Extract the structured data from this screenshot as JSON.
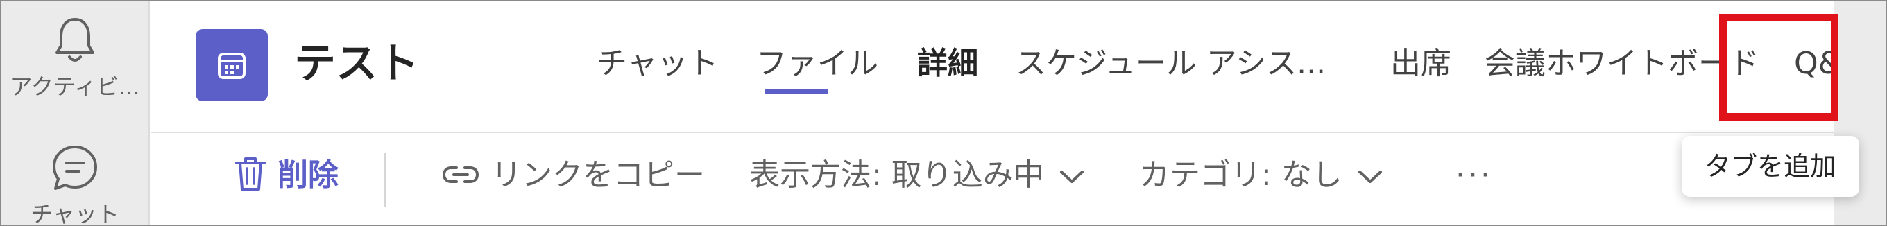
{
  "rail": {
    "items": [
      {
        "label": "アクティビ...",
        "icon": "bell-icon"
      },
      {
        "label": "チャット",
        "icon": "chat-icon"
      }
    ]
  },
  "header": {
    "app_icon": "calendar-icon",
    "title": "テスト",
    "tabs": [
      {
        "label": "チャット",
        "active": false
      },
      {
        "label": "ファイル",
        "active": false
      },
      {
        "label": "詳細",
        "active": true
      },
      {
        "label": "スケジュール アシス...",
        "active": false
      },
      {
        "label": "出席",
        "active": false
      },
      {
        "label": "会議ホワイトボード",
        "active": false
      },
      {
        "label": "Q&A",
        "active": false
      }
    ],
    "add_tab_icon": "plus-icon"
  },
  "toolbar": {
    "delete_label": "削除",
    "copy_link_label": "リンクをコピー",
    "display_label": "表示方法: 取り込み中",
    "category_label": "カテゴリ: なし",
    "more_label": "···"
  },
  "tooltip": {
    "text": "タブを追加"
  },
  "colors": {
    "accent": "#5b5fc7",
    "highlight": "#e0131b",
    "rail_bg": "#ebebeb"
  }
}
